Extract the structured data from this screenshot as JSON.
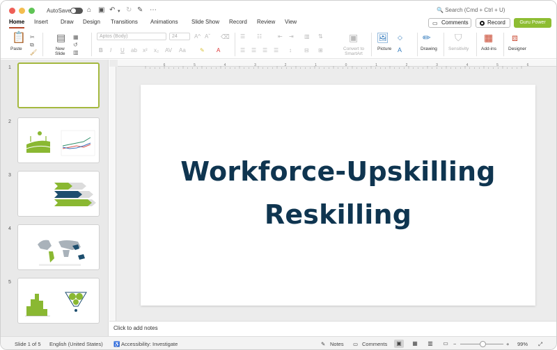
{
  "titlebar": {
    "autosave_label": "AutoSave",
    "search_placeholder": "Search (Cmd + Ctrl + U)"
  },
  "tabs": [
    "Home",
    "Insert",
    "Draw",
    "Design",
    "Transitions",
    "Animations",
    "Slide Show",
    "Record",
    "Review",
    "View"
  ],
  "header_buttons": {
    "comments": "Comments",
    "record": "Record",
    "guru": "Guru Power"
  },
  "ribbon": {
    "paste": "Paste",
    "new_slide": "New\nSlide",
    "font_name": "Aptos (Body)",
    "font_size": "24",
    "convert_smartart": "Convert to\nSmartArt",
    "picture": "Picture",
    "drawing": "Drawing",
    "sensitivity": "Sensitivity",
    "add_ins": "Add-ins",
    "designer": "Designer"
  },
  "slides": [
    {
      "num": "1"
    },
    {
      "num": "2"
    },
    {
      "num": "3"
    },
    {
      "num": "4"
    },
    {
      "num": "5"
    }
  ],
  "main_slide": {
    "title_line1": "Workforce-Upskilling",
    "title_line2": "Reskilling"
  },
  "notes_placeholder": "Click to add notes",
  "status": {
    "slide_info": "Slide 1 of 5",
    "language": "English (United States)",
    "accessibility": "Accessibility: Investigate",
    "notes": "Notes",
    "comments": "Comments",
    "zoom": "99%"
  },
  "colors": {
    "accent_tab": "#b7472a",
    "guru_button": "#8dbd32",
    "title_text": "#0f3550",
    "thumb_green": "#8ab832",
    "thumb_navy": "#1d4e6e"
  },
  "ruler_numbers": [
    "6",
    "5",
    "4",
    "3",
    "2",
    "1",
    "0",
    "1",
    "2",
    "3",
    "4",
    "5",
    "6"
  ]
}
